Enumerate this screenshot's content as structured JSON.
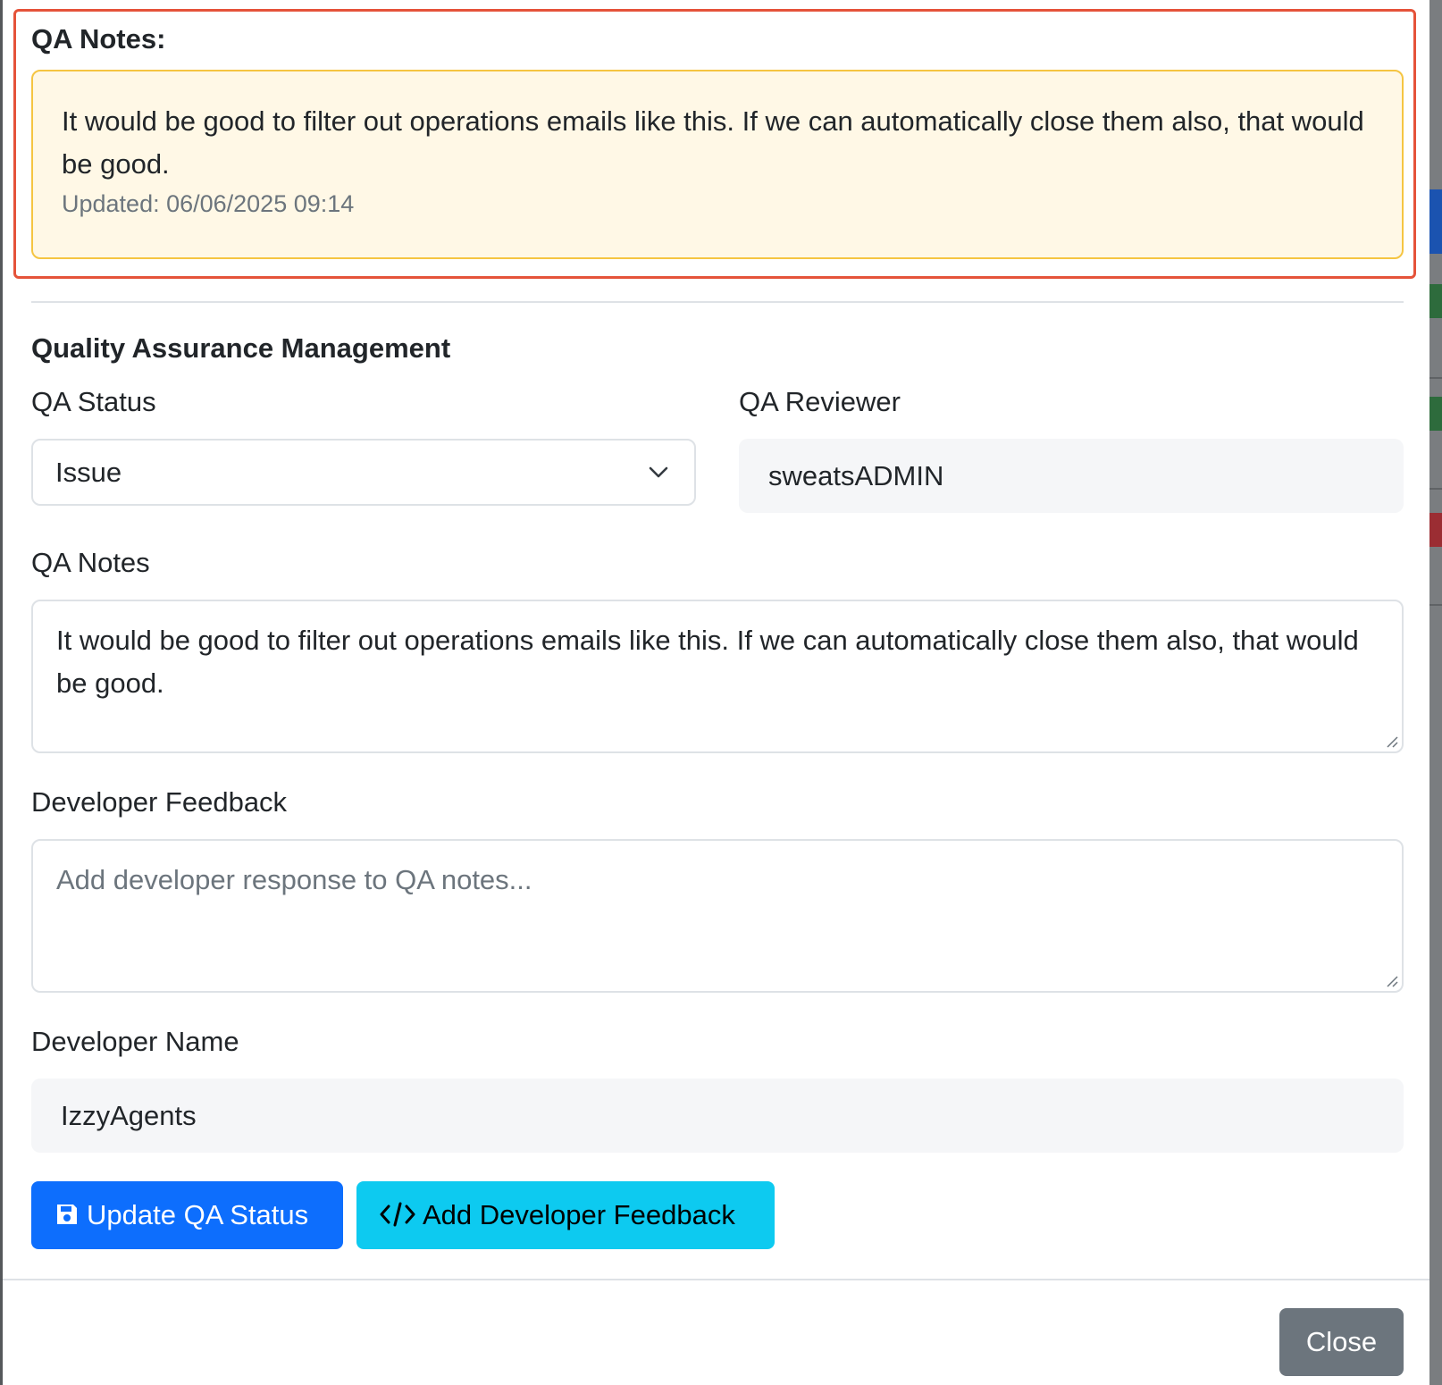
{
  "qa_notes_panel": {
    "heading": "QA Notes:",
    "note_text": "It would be good to filter out operations emails like this. If we can automatically close them also, that would be good.",
    "updated": "Updated: 06/06/2025 09:14",
    "highlight_color": "#e5533a"
  },
  "qa_management": {
    "section_title": "Quality Assurance Management",
    "status_label": "QA Status",
    "status_value": "Issue",
    "reviewer_label": "QA Reviewer",
    "reviewer_value": "sweatsADMIN",
    "notes_label": "QA Notes",
    "notes_value": "It would be good to filter out operations emails like this. If we can automatically close them also, that would be good.",
    "dev_feedback_label": "Developer Feedback",
    "dev_feedback_placeholder": "Add developer response to QA notes...",
    "dev_name_label": "Developer Name",
    "dev_name_value": "IzzyAgents"
  },
  "buttons": {
    "update_status": "Update QA Status",
    "add_feedback": "Add Developer Feedback",
    "close": "Close",
    "update_icon": "floppy-disk-icon",
    "feedback_icon": "code-icon"
  },
  "colors": {
    "primary": "#0d6efd",
    "info": "#0dcaf0",
    "secondary": "#6c757d",
    "alert_bg": "#fff8e6",
    "alert_border": "#f5c542"
  }
}
